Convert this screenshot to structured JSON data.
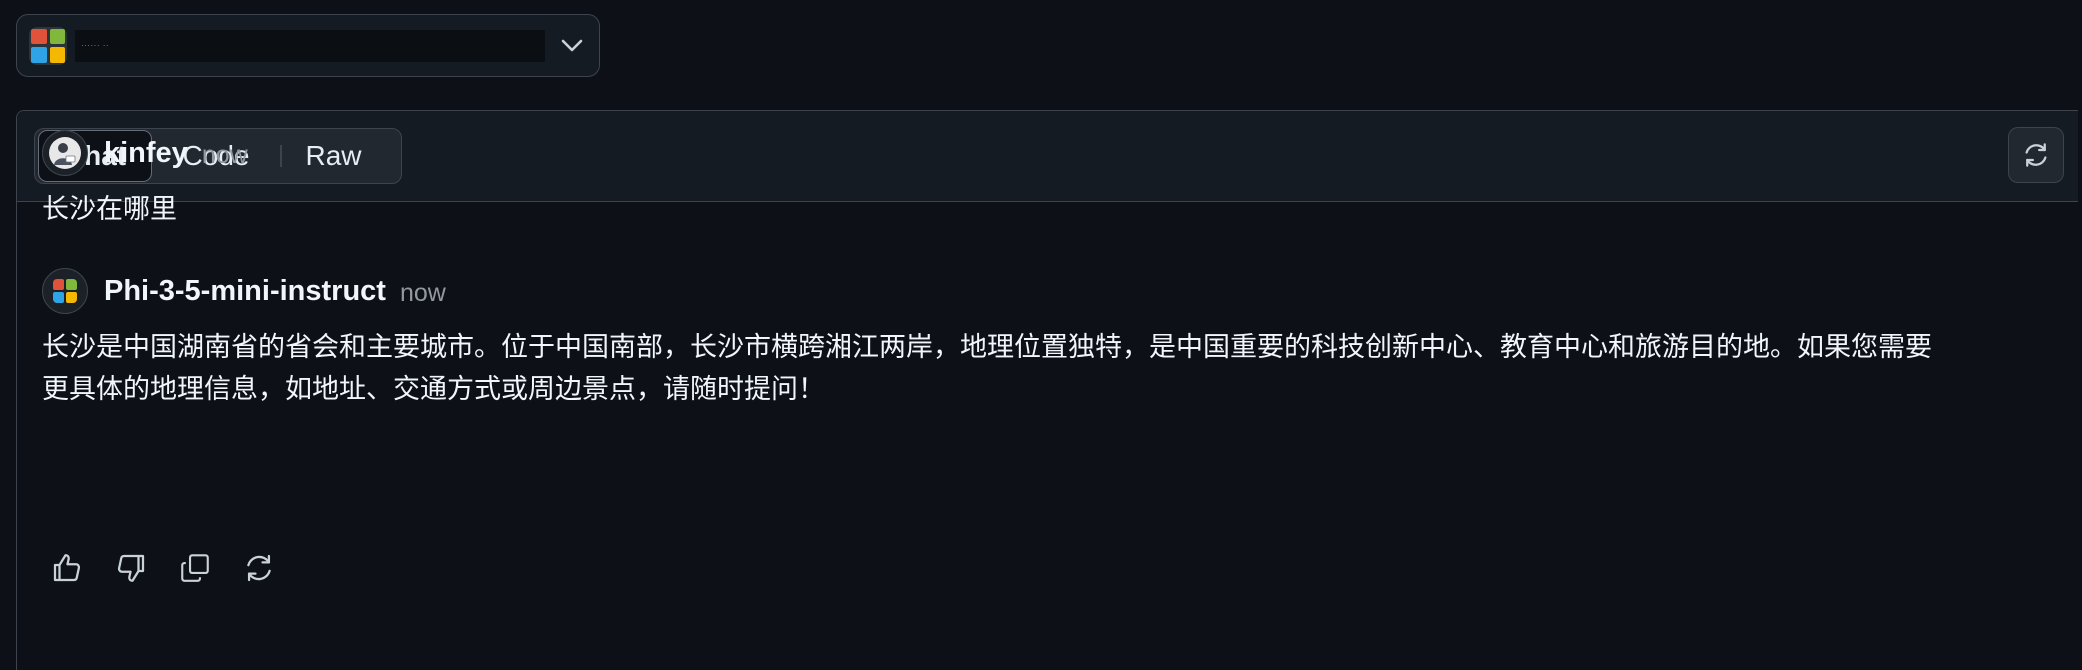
{
  "model_selector": {
    "logo_icon": "microsoft-logo-icon",
    "value": "······ ··",
    "chevron_icon": "chevron-down-icon"
  },
  "tabs": [
    {
      "label": "Chat",
      "active": true
    },
    {
      "label": "Code",
      "active": false
    },
    {
      "label": "Raw",
      "active": false
    }
  ],
  "header": {
    "refresh_icon": "refresh-icon"
  },
  "messages": [
    {
      "author": "kinfey",
      "time": "now",
      "avatar": "user-avatar",
      "text": "长沙在哪里"
    },
    {
      "author": "Phi-3-5-mini-instruct",
      "time": "now",
      "avatar": "microsoft-logo-icon",
      "text_line1": "长沙是中国湖南省的省会和主要城市。位于中国南部，长沙市横跨湘江两岸，地理位置独特，是中国重要的科技创新中心、教育中心和旅游目的地。如果您需要",
      "text_line2": "更具体的地理信息，如地址、交通方式或周边景点，请随时提问！"
    }
  ],
  "message_actions": [
    {
      "icon": "thumbs-up-icon"
    },
    {
      "icon": "thumbs-down-icon"
    },
    {
      "icon": "copy-icon"
    },
    {
      "icon": "regenerate-icon"
    }
  ],
  "colors": {
    "background": "#0d1117",
    "panel_header": "#151b23",
    "border": "#3d444d",
    "text": "#f0f6fc",
    "muted": "#9198a1"
  }
}
